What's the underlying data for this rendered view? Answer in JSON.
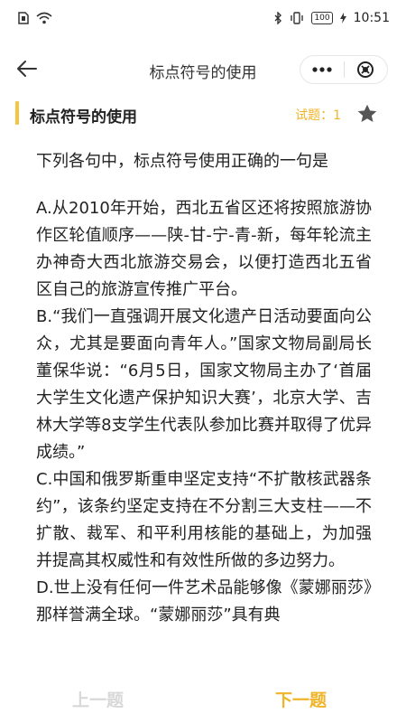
{
  "status_bar": {
    "time": "10:51",
    "battery": "100"
  },
  "nav": {
    "title": "标点符号的使用"
  },
  "header": {
    "title": "标点符号的使用",
    "counter": "试题：1"
  },
  "question": {
    "stem": "下列各句中，标点符号使用正确的一句是",
    "options": [
      "A.从2010年开始，西北五省区还将按照旅游协作区轮值顺序——陕-甘-宁-青-新，每年轮流主办神奇大西北旅游交易会，以便打造西北五省区自己的旅游宣传推广平台。",
      "B.“我们一直强调开展文化遗产日活动要面向公众，尤其是要面向青年人。”国家文物局副局长董保华说：“6月5日，国家文物局主办了‘首届大学生文化遗产保护知识大赛’，北京大学、吉林大学等8支学生代表队参加比赛并取得了优异成绩。”",
      "C.中国和俄罗斯重申坚定支持“不扩散核武器条约”，该条约坚定支持在不分割三大支柱——不扩散、裁军、和平利用核能的基础上，为加强并提高其权威性和有效性所做的多边努力。",
      "D.世上没有任何一件艺术品能够像《蒙娜丽莎》那样誉满全球。“蒙娜丽莎”具有典"
    ]
  },
  "footer": {
    "prev_label": "上一题",
    "next_label": "下一题"
  },
  "colors": {
    "accent": "#f0b429",
    "accent_bar": "#f5c542",
    "disabled": "#d8d8d8"
  }
}
